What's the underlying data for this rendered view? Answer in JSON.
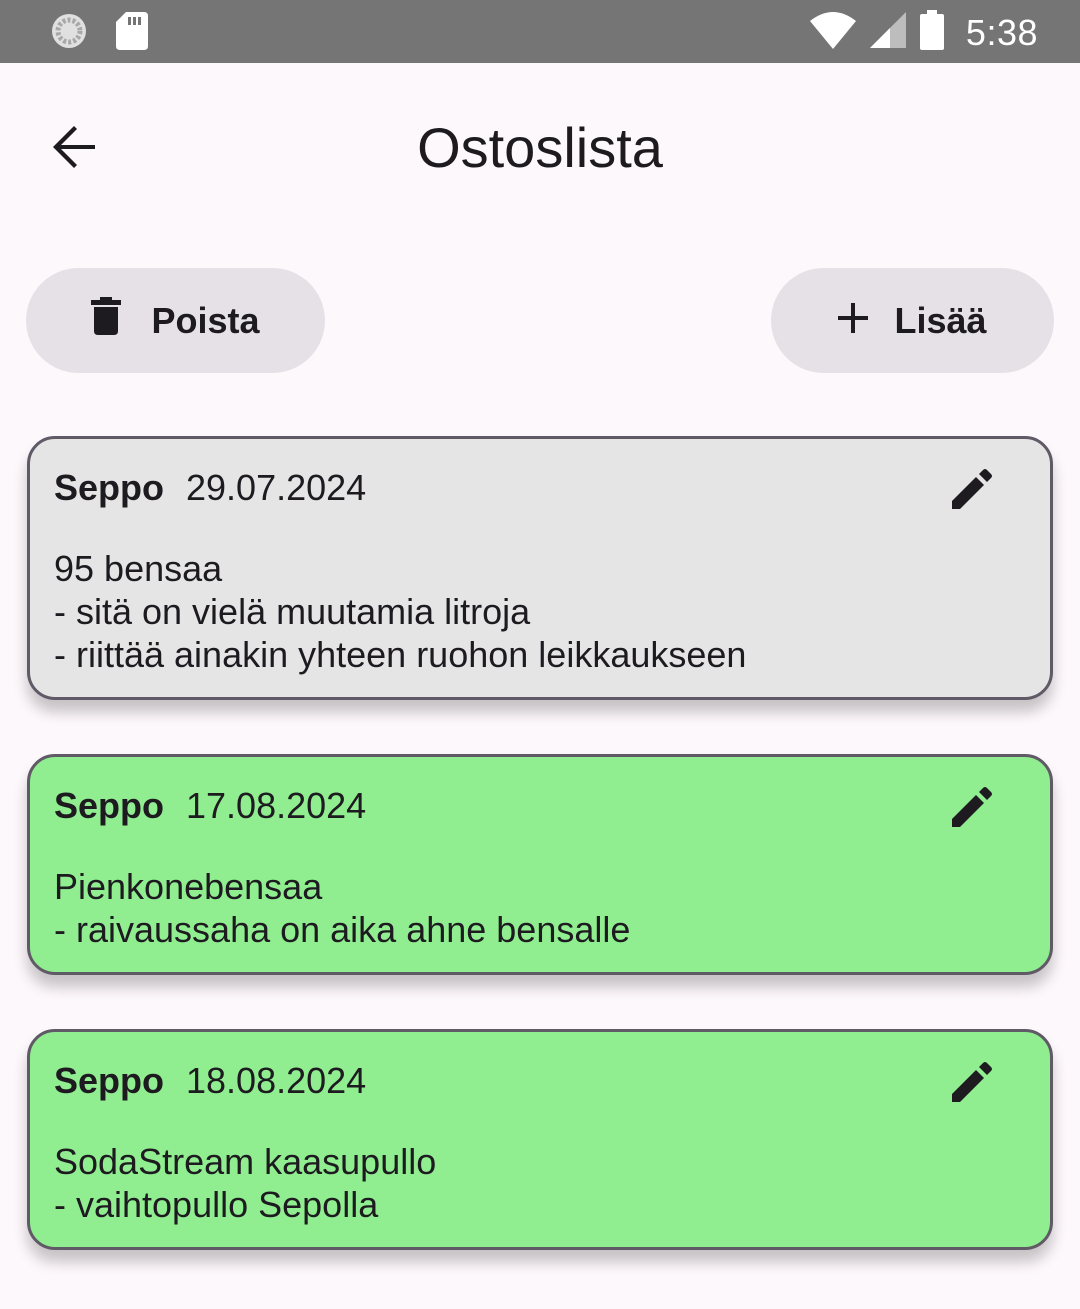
{
  "status_bar": {
    "time": "5:38",
    "icons": [
      "loading-circle-icon",
      "sd-card-icon",
      "wifi-icon",
      "cell-signal-icon",
      "battery-icon"
    ],
    "background": "#757575"
  },
  "app_bar": {
    "title": "Ostoslista",
    "back_icon": "arrow-back-icon"
  },
  "actions": {
    "delete_label": "Poista",
    "delete_icon": "trash-icon",
    "add_label": "Lisää",
    "add_icon": "plus-icon",
    "button_color": "#e6e1e6"
  },
  "items": [
    {
      "author": "Seppo",
      "date": "29.07.2024",
      "lines": [
        "95 bensaa",
        "- sitä on vielä muutamia litroja",
        "- riittää ainakin yhteen ruohon leikkaukseen"
      ],
      "color": "#e5e5e5"
    },
    {
      "author": "Seppo",
      "date": "17.08.2024",
      "lines": [
        "Pienkonebensaa",
        "- raivaussaha on aika ahne bensalle"
      ],
      "color": "#90ee90"
    },
    {
      "author": "Seppo",
      "date": "18.08.2024",
      "lines": [
        "SodaStream kaasupullo",
        "- vaihtopullo Sepolla"
      ],
      "color": "#90ee90"
    }
  ]
}
